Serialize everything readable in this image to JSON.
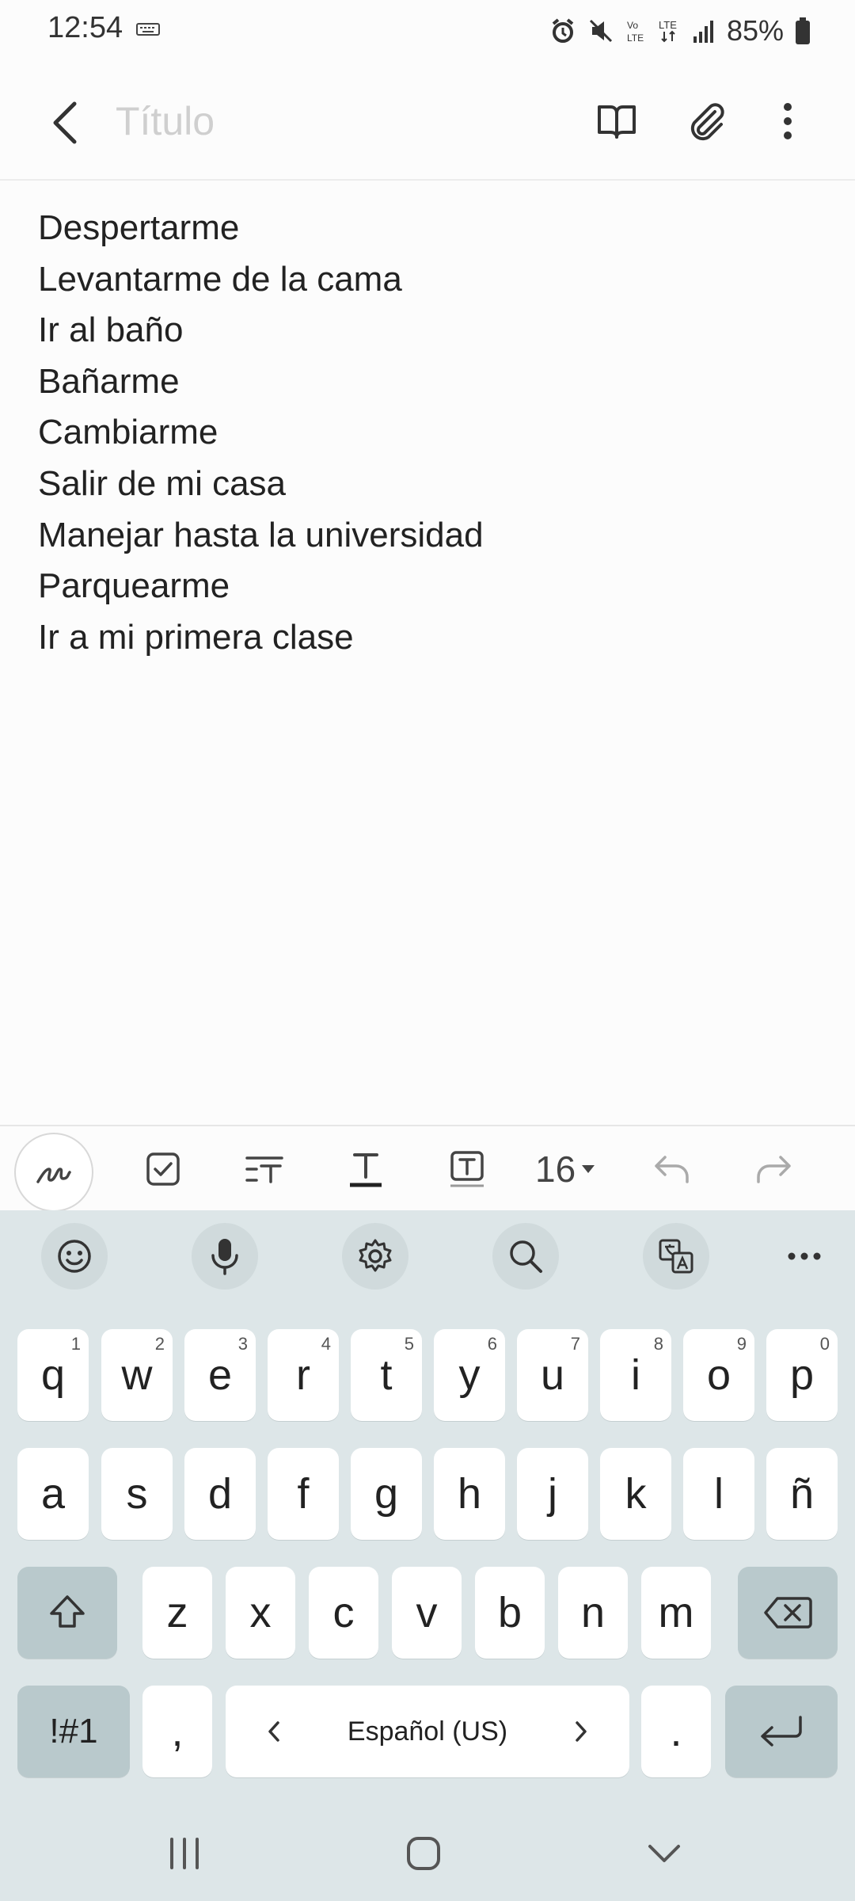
{
  "status_bar": {
    "time": "12:54",
    "battery": "85%",
    "icons": [
      "keyboard-icon",
      "alarm-icon",
      "mute-icon",
      "volte-icon",
      "lte-icon",
      "signal-icon",
      "battery-icon"
    ]
  },
  "app_bar": {
    "title_placeholder": "Título",
    "icons": [
      "back-icon",
      "reading-mode-icon",
      "attach-icon",
      "more-icon"
    ]
  },
  "note": {
    "lines": [
      "Despertarme",
      "Levantarme de la cama",
      "Ir al baño",
      "Bañarme",
      "Cambiarme",
      "Salir de mi casa",
      "Manejar hasta la universidad",
      "Parquearme",
      "Ir a mi primera clase"
    ]
  },
  "format_toolbar": {
    "font_size": "16",
    "icons": [
      "pen-icon",
      "checkbox-icon",
      "paragraph-style-icon",
      "text-style-icon",
      "text-box-icon",
      "undo-icon",
      "redo-icon"
    ]
  },
  "keyboard": {
    "tools": [
      "emoji-icon",
      "mic-icon",
      "settings-icon",
      "search-icon",
      "translate-icon",
      "more-icon"
    ],
    "row1": [
      {
        "k": "q",
        "h": "1"
      },
      {
        "k": "w",
        "h": "2"
      },
      {
        "k": "e",
        "h": "3"
      },
      {
        "k": "r",
        "h": "4"
      },
      {
        "k": "t",
        "h": "5"
      },
      {
        "k": "y",
        "h": "6"
      },
      {
        "k": "u",
        "h": "7"
      },
      {
        "k": "i",
        "h": "8"
      },
      {
        "k": "o",
        "h": "9"
      },
      {
        "k": "p",
        "h": "0"
      }
    ],
    "row2": [
      "a",
      "s",
      "d",
      "f",
      "g",
      "h",
      "j",
      "k",
      "l",
      "ñ"
    ],
    "row3": [
      "z",
      "x",
      "c",
      "v",
      "b",
      "n",
      "m"
    ],
    "symbols_label": "!#1",
    "comma": ",",
    "space_label": "Español (US)",
    "period": "."
  },
  "nav_bar": {
    "icons": [
      "recents-icon",
      "home-icon",
      "hide-keyboard-icon"
    ]
  },
  "colors": {
    "background": "#fcfcfc",
    "keyboard_bg": "#dde6e8",
    "key_bg": "#ffffff",
    "special_key_bg": "#b9c9cc",
    "placeholder": "#cfcfcf"
  }
}
